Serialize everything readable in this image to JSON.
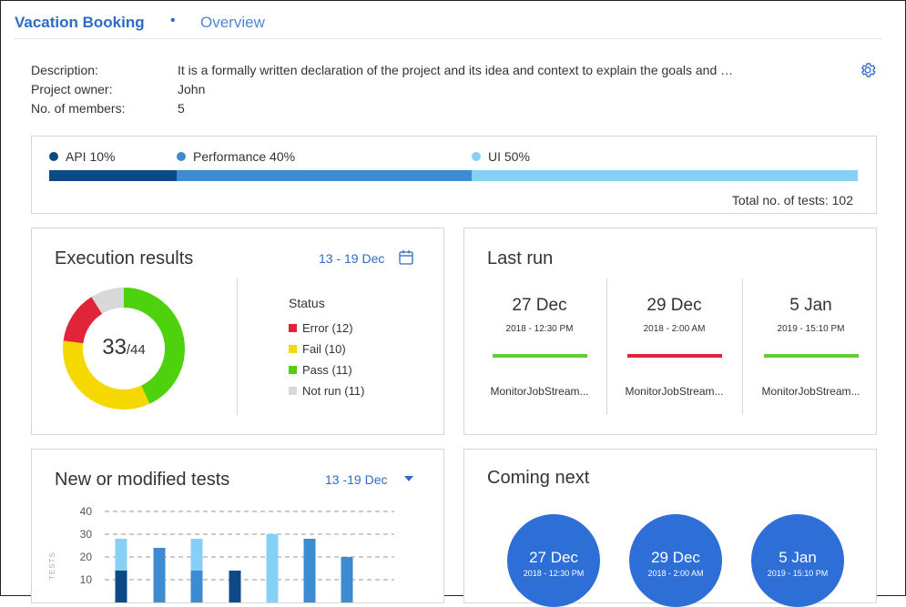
{
  "header": {
    "title": "Vacation Booking",
    "separator": "•",
    "tab": "Overview"
  },
  "meta": {
    "description_label": "Description:",
    "description_value": "It is a formally written declaration of the project and its idea and context to explain the goals and …",
    "owner_label": "Project owner:",
    "owner_value": "John",
    "members_label": "No. of members:",
    "members_value": "5"
  },
  "distribution": {
    "items": [
      {
        "label": "API 10%",
        "percent": 10,
        "color": "#0b4a87"
      },
      {
        "label": "Performance 40%",
        "percent": 40,
        "color": "#3d8bd0"
      },
      {
        "label": "UI 50%",
        "percent": 50,
        "color": "#86d0f5"
      }
    ],
    "total_text": "Total no. of tests: 102"
  },
  "execution": {
    "title": "Execution results",
    "date_range": "13 - 19 Dec",
    "passed_count": "33",
    "total_count": "/44",
    "status_title": "Status",
    "statuses": [
      {
        "label": "Error (12)",
        "value": 12,
        "color": "#e0243a"
      },
      {
        "label": "Fail (10)",
        "value": 10,
        "color": "#f5d800"
      },
      {
        "label": "Pass (11)",
        "value": 11,
        "color": "#4fd20e"
      },
      {
        "label": "Not run (11)",
        "value": 11,
        "color": "#d8d8d8"
      }
    ],
    "donut_segments": [
      {
        "name": "pass",
        "fraction": 0.43,
        "color": "#4fd20e"
      },
      {
        "name": "fail",
        "fraction": 0.34,
        "color": "#f5d800"
      },
      {
        "name": "error",
        "fraction": 0.14,
        "color": "#e0243a"
      },
      {
        "name": "not-run",
        "fraction": 0.09,
        "color": "#d8d8d8"
      }
    ]
  },
  "last_run": {
    "title": "Last run",
    "runs": [
      {
        "date": "27 Dec",
        "sub": "2018 - 12:30 PM",
        "name": "MonitorJobStream...",
        "color": "#66cc33"
      },
      {
        "date": "29 Dec",
        "sub": "2018 - 2:00 AM",
        "name": "MonitorJobStream...",
        "color": "#e0243a"
      },
      {
        "date": "5 Jan",
        "sub": "2019 - 15:10 PM",
        "name": "MonitorJobStream...",
        "color": "#66cc33"
      }
    ]
  },
  "new_tests": {
    "title": "New or modified tests",
    "date_range": "13 -19 Dec",
    "y_axis_title": "TESTS"
  },
  "chart_data": {
    "type": "bar",
    "y_ticks": [
      "40",
      "30",
      "20",
      "10"
    ],
    "ylim": [
      0,
      40
    ],
    "grid": true,
    "series": [
      {
        "color": "#0b4a87",
        "values": [
          14,
          0,
          0,
          14,
          0,
          0,
          0
        ]
      },
      {
        "color": "#3d8bd0",
        "values": [
          0,
          24,
          14,
          0,
          0,
          28,
          20
        ]
      },
      {
        "color": "#86d0f5",
        "values": [
          14,
          0,
          14,
          0,
          30,
          0,
          0
        ]
      }
    ]
  },
  "coming_next": {
    "title": "Coming next",
    "items": [
      {
        "date": "27 Dec",
        "sub": "2018 - 12:30 PM"
      },
      {
        "date": "29 Dec",
        "sub": "2018 - 2:00 AM"
      },
      {
        "date": "5 Jan",
        "sub": "2019 - 15:10 PM"
      }
    ]
  },
  "colors": {
    "accent": "#2c6bc7",
    "circle": "#2d6fd6"
  }
}
